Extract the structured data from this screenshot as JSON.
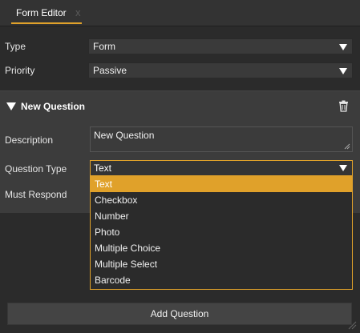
{
  "tabs": [
    {
      "label": "Form Editor",
      "close": "x"
    }
  ],
  "form": {
    "type_label": "Type",
    "type_value": "Form",
    "priority_label": "Priority",
    "priority_value": "Passive"
  },
  "question": {
    "section_title": "New Question",
    "delete_icon": "trash-icon",
    "description_label": "Description",
    "description_value": "New Question",
    "question_type_label": "Question Type",
    "question_type_value": "Text",
    "must_respond_label": "Must Respond",
    "question_type_options": [
      "Text",
      "Checkbox",
      "Number",
      "Photo",
      "Multiple Choice",
      "Multiple Select",
      "Barcode"
    ],
    "selected_index": 0
  },
  "footer": {
    "add_question_label": "Add Question"
  },
  "colors": {
    "accent": "#e0a12a",
    "background": "#2b2b2b",
    "panel": "#3c3c3c"
  }
}
